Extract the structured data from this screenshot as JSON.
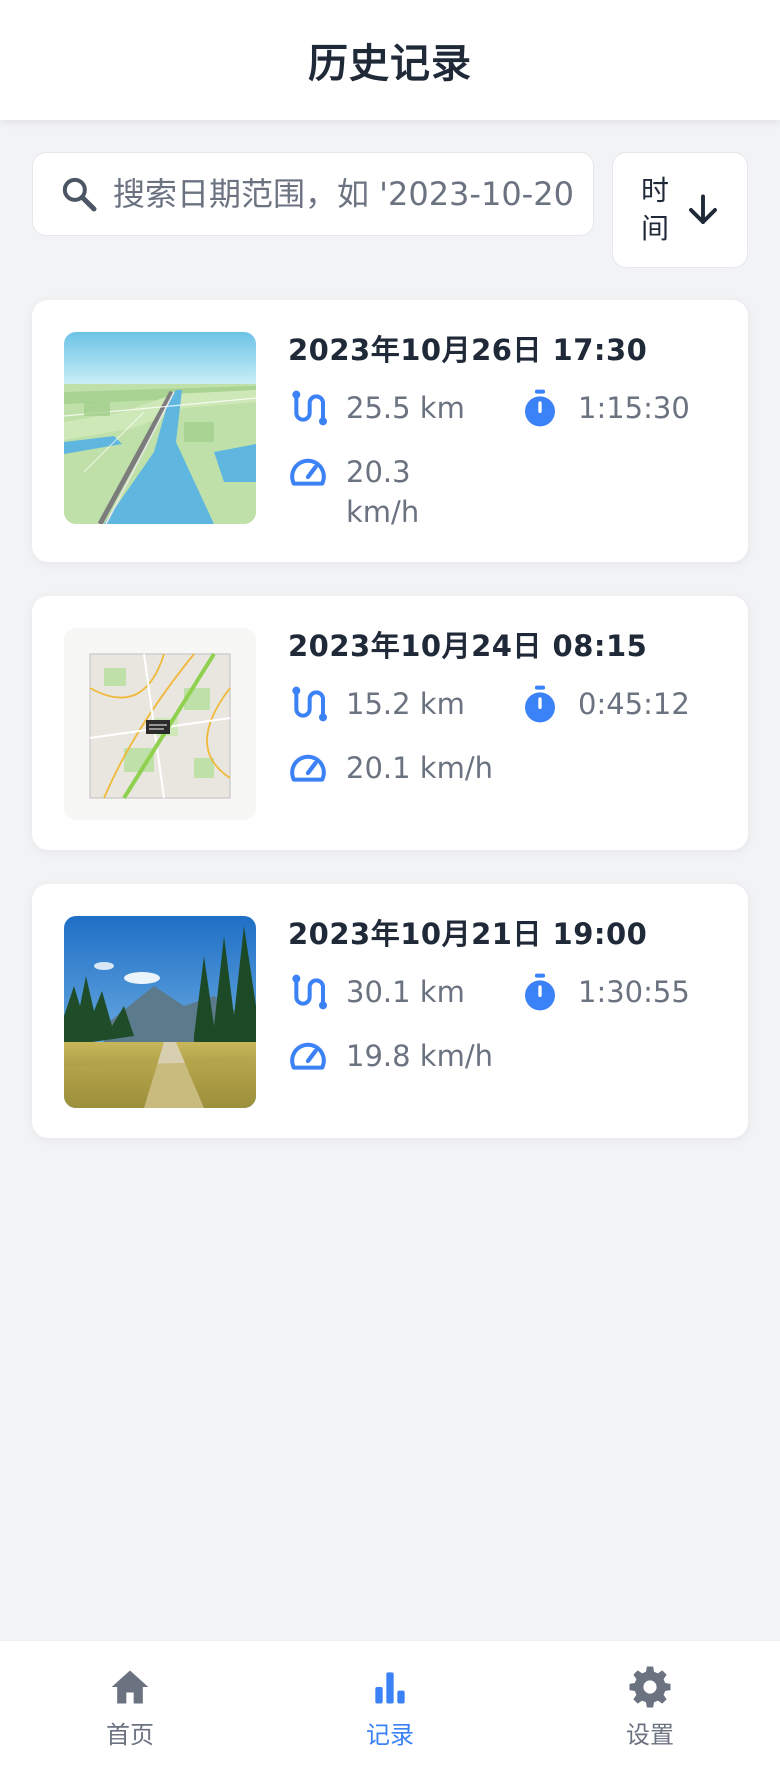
{
  "header": {
    "title": "历史记录"
  },
  "search": {
    "placeholder": "搜索日期范围，如 '2023-10-20",
    "value": ""
  },
  "sort": {
    "label": "时间",
    "icon": "arrow-down-icon"
  },
  "records": [
    {
      "date": "2023年10月26日 17:30",
      "distance": "25.5 km",
      "duration": "1:15:30",
      "speed": "20.3 km/h",
      "thumbnail": "river-map-image"
    },
    {
      "date": "2023年10月24日 08:15",
      "distance": "15.2 km",
      "duration": "0:45:12",
      "speed": "20.1 km/h",
      "thumbnail": "city-map-image"
    },
    {
      "date": "2023年10月21日 19:00",
      "distance": "30.1 km",
      "duration": "1:30:55",
      "speed": "19.8 km/h",
      "thumbnail": "trail-landscape-image"
    }
  ],
  "nav": {
    "items": [
      {
        "label": "首页",
        "icon": "home-icon",
        "active": false
      },
      {
        "label": "记录",
        "icon": "bar-chart-icon",
        "active": true
      },
      {
        "label": "设置",
        "icon": "gear-icon",
        "active": false
      }
    ]
  },
  "colors": {
    "accent": "#3b82f6",
    "muted_text": "#6b7280",
    "background": "#f2f3f5"
  }
}
